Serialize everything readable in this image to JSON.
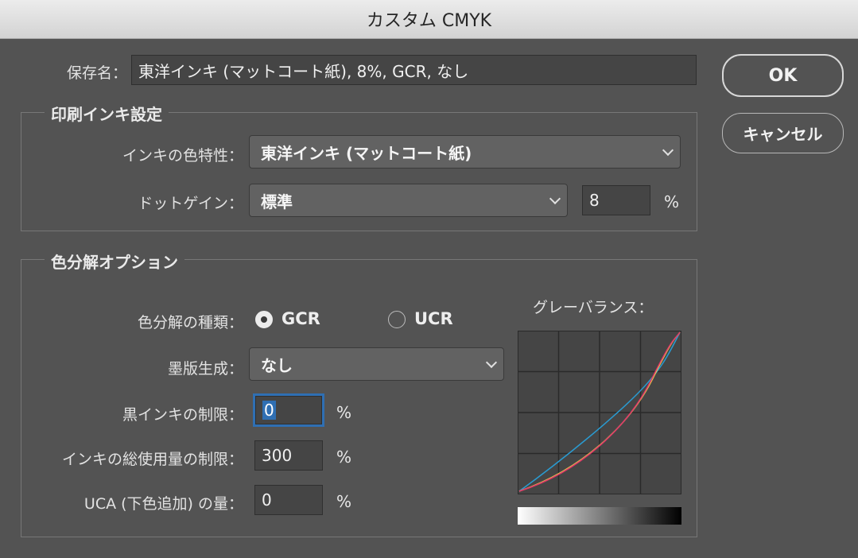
{
  "window": {
    "title": "カスタム CMYK"
  },
  "buttons": {
    "ok": "OK",
    "cancel": "キャンセル"
  },
  "save_name": {
    "label": "保存名：",
    "value": "東洋インキ (マットコート紙), 8%, GCR, なし"
  },
  "ink_settings": {
    "title": "印刷インキ設定",
    "ink_colors_label": "インキの色特性：",
    "ink_colors_value": "東洋インキ (マットコート紙)",
    "dot_gain_label": "ドットゲイン：",
    "dot_gain_mode": "標準",
    "dot_gain_value": "8",
    "dot_gain_unit": "%"
  },
  "separation": {
    "title": "色分解オプション",
    "type_label": "色分解の種類：",
    "type_options": [
      "GCR",
      "UCR"
    ],
    "type_selected": "GCR",
    "black_gen_label": "墨版生成：",
    "black_gen_value": "なし",
    "black_limit_label": "黒インキの制限：",
    "black_limit_value": "0",
    "total_ink_label": "インキの総使用量の制限：",
    "total_ink_value": "300",
    "uca_label": "UCA (下色追加) の量：",
    "uca_value": "0",
    "unit": "%"
  },
  "gray_balance": {
    "title": "グレーバランス：",
    "colors": {
      "cyan": "#2a9bd1",
      "magenta": "#e0386a",
      "yellow": "#e8d94a",
      "black": "#222222"
    }
  }
}
